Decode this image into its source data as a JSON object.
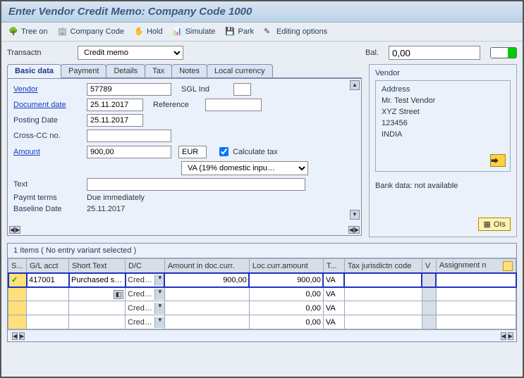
{
  "title": "Enter Vendor Credit Memo: Company Code 1000",
  "toolbar": {
    "tree": "Tree on",
    "company": "Company Code",
    "hold": "Hold",
    "simulate": "Simulate",
    "park": "Park",
    "editing": "Editing options"
  },
  "trans": {
    "label": "Transactn",
    "value": "Credit memo"
  },
  "balance": {
    "label": "Bal.",
    "value": "0,00"
  },
  "tabs": [
    "Basic data",
    "Payment",
    "Details",
    "Tax",
    "Notes",
    "Local currency"
  ],
  "form": {
    "vendor_label": "Vendor",
    "vendor": "57789",
    "sgl_label": "SGL Ind",
    "sgl": "",
    "docdate_label": "Document date",
    "docdate": "25.11.2017",
    "ref_label": "Reference",
    "ref": "",
    "postdate_label": "Posting Date",
    "postdate": "25.11.2017",
    "crosscc_label": "Cross-CC no.",
    "crosscc": "",
    "amount_label": "Amount",
    "amount": "900,00",
    "currency": "EUR",
    "calctax_label": "Calculate tax",
    "taxcode": "VA (19% domestic inpu…",
    "text_label": "Text",
    "text": "",
    "paymt_label": "Paymt terms",
    "paymt": "Due immediately",
    "baseline_label": "Baseline Date",
    "baseline": "25.11.2017"
  },
  "vendor_box": {
    "title": "Vendor",
    "addr_title": "Address",
    "lines": [
      "Mr. Test Vendor",
      "XYZ Street",
      "123456",
      "INDIA"
    ],
    "bank": "Bank data: not available",
    "ois": "OIs"
  },
  "items": {
    "title": "1 Items ( No entry variant selected )",
    "cols": [
      "S...",
      "G/L acct",
      "Short Text",
      "D/C",
      "Amount in doc.curr.",
      "Loc.curr.amount",
      "T...",
      "Tax jurisdictn code",
      "V",
      "Assignment n"
    ],
    "rows": [
      {
        "sel": "✓",
        "gl": "417001",
        "short": "Purchased s…",
        "dc": "Cred…",
        "amt": "900,00",
        "loc": "900,00",
        "tax": "VA",
        "jur": "",
        "v": "",
        "assign": "",
        "hl": true
      },
      {
        "sel": "",
        "gl": "",
        "short": "",
        "dc": "Cred…",
        "amt": "",
        "loc": "0,00",
        "tax": "VA",
        "jur": "",
        "v": "",
        "assign": "",
        "hl": false
      },
      {
        "sel": "",
        "gl": "",
        "short": "",
        "dc": "Cred…",
        "amt": "",
        "loc": "0,00",
        "tax": "VA",
        "jur": "",
        "v": "",
        "assign": "",
        "hl": false
      },
      {
        "sel": "",
        "gl": "",
        "short": "",
        "dc": "Cred…",
        "amt": "",
        "loc": "0,00",
        "tax": "VA",
        "jur": "",
        "v": "",
        "assign": "",
        "hl": false
      }
    ]
  }
}
